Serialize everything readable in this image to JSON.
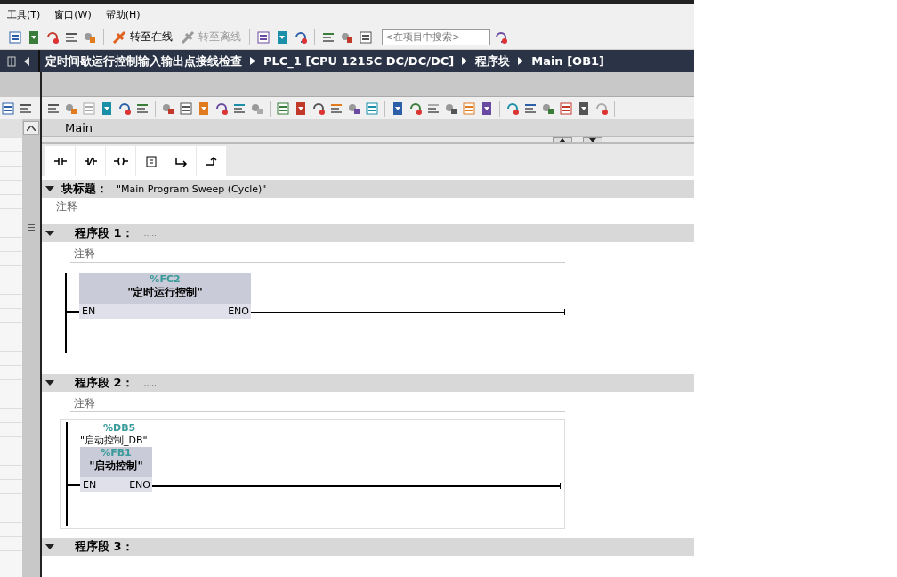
{
  "menu": [
    {
      "label": "工具(T)"
    },
    {
      "label": "窗口(W)"
    },
    {
      "label": "帮助(H)"
    }
  ],
  "toolbar": {
    "online": {
      "label": "转至在线",
      "disabled": false
    },
    "offline": {
      "label": "转至离线",
      "disabled": true
    },
    "search": {
      "placeholder": "<在项目中搜索>"
    }
  },
  "breadcrumb": [
    "定时间歇运行控制输入输出点接线检查",
    "PLC_1 [CPU 1215C DC/DC/DC]",
    "程序块",
    "Main [OB1]"
  ],
  "editor": {
    "block_name": "Main",
    "block_title": {
      "label": "块标题：",
      "value": "\"Main Program Sweep (Cycle)\"",
      "comment": "注释",
      "expanded": true
    },
    "networks": [
      {
        "label": "程序段 1：",
        "title": ".....",
        "comment": "注释",
        "expanded": true,
        "box": {
          "kind": "fc",
          "address": "%FC2",
          "name": "\"定时运行控制\"",
          "en": "EN",
          "eno": "ENO"
        }
      },
      {
        "label": "程序段 2：",
        "title": ".....",
        "comment": "注释",
        "expanded": true,
        "instance": {
          "address": "%DB5",
          "name": "\"启动控制_DB\""
        },
        "box": {
          "kind": "fb",
          "address": "%FB1",
          "name": "\"启动控制\"",
          "en": "EN",
          "eno": "ENO"
        }
      },
      {
        "label": "程序段 3：",
        "title": ".....",
        "expanded": true
      }
    ]
  }
}
